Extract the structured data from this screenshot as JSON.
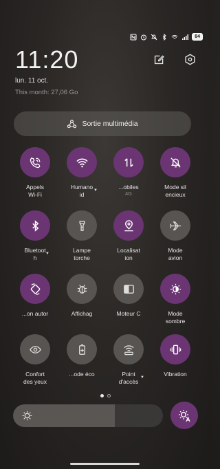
{
  "status": {
    "battery": "84"
  },
  "header": {
    "time": "11:20",
    "date": "lun. 11 oct.",
    "data_usage": "This month: 27,06 Go"
  },
  "media": {
    "label": "Sortie multimédia"
  },
  "tiles": [
    {
      "label": "Appels\nWi-Fi",
      "state": "on",
      "icon": "wifi-call-icon"
    },
    {
      "label": "Humano\nid",
      "state": "on",
      "icon": "wifi-icon",
      "caret": true
    },
    {
      "label": "...obiles",
      "sub": "4G",
      "state": "on",
      "icon": "mobile-data-icon"
    },
    {
      "label": "Mode sil\nencieux",
      "state": "on",
      "icon": "bell-off-icon"
    },
    {
      "label": "Bluetoot\nh",
      "state": "on",
      "icon": "bluetooth-icon",
      "caret": true
    },
    {
      "label": "Lampe\ntorche",
      "state": "off",
      "icon": "flashlight-icon"
    },
    {
      "label": "Localisat\nion",
      "state": "on",
      "icon": "location-icon"
    },
    {
      "label": "Mode\navion",
      "state": "off",
      "icon": "airplane-icon"
    },
    {
      "label": "...on autor",
      "state": "on",
      "icon": "auto-rotate-icon"
    },
    {
      "label": "Affichag",
      "state": "off",
      "icon": "bug-icon"
    },
    {
      "label": "Moteur C",
      "state": "off",
      "icon": "screen-mode-icon"
    },
    {
      "label": "Mode\nsombre",
      "state": "on",
      "icon": "dark-mode-icon"
    },
    {
      "label": "Confort\ndes yeux",
      "state": "off",
      "icon": "eye-icon"
    },
    {
      "label": "...ode éco",
      "state": "off",
      "icon": "battery-saver-icon"
    },
    {
      "label": "Point\nd'accès",
      "state": "off",
      "icon": "hotspot-icon",
      "caret": true
    },
    {
      "label": "Vibration",
      "state": "on",
      "icon": "vibration-icon"
    }
  ],
  "brightness": {
    "level": 0.68
  },
  "colors": {
    "accent": "#6b3574",
    "inactive_tile": "#575452"
  }
}
